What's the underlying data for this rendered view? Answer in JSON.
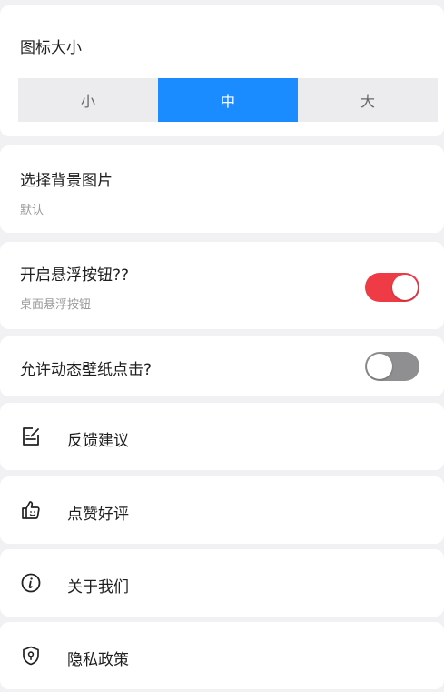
{
  "icon_size": {
    "title": "图标大小",
    "options": [
      "小",
      "中",
      "大"
    ],
    "selected": "中"
  },
  "background": {
    "title": "选择背景图片",
    "value": "默认"
  },
  "floating_button": {
    "title": "开启悬浮按钮??",
    "subtitle": "桌面悬浮按钮",
    "enabled": true
  },
  "live_wallpaper": {
    "title": "允许动态壁纸点击?",
    "enabled": false
  },
  "menu": [
    {
      "label": "反馈建议",
      "icon": "feedback-edit-icon"
    },
    {
      "label": "点赞好评",
      "icon": "thumbs-up-icon"
    },
    {
      "label": "关于我们",
      "icon": "info-icon"
    },
    {
      "label": "隐私政策",
      "icon": "shield-icon"
    }
  ],
  "colors": {
    "accent": "#1a8cff",
    "toggle_on": "#ee3b46",
    "toggle_off": "#8f8f92",
    "background": "#f1f1f3"
  }
}
